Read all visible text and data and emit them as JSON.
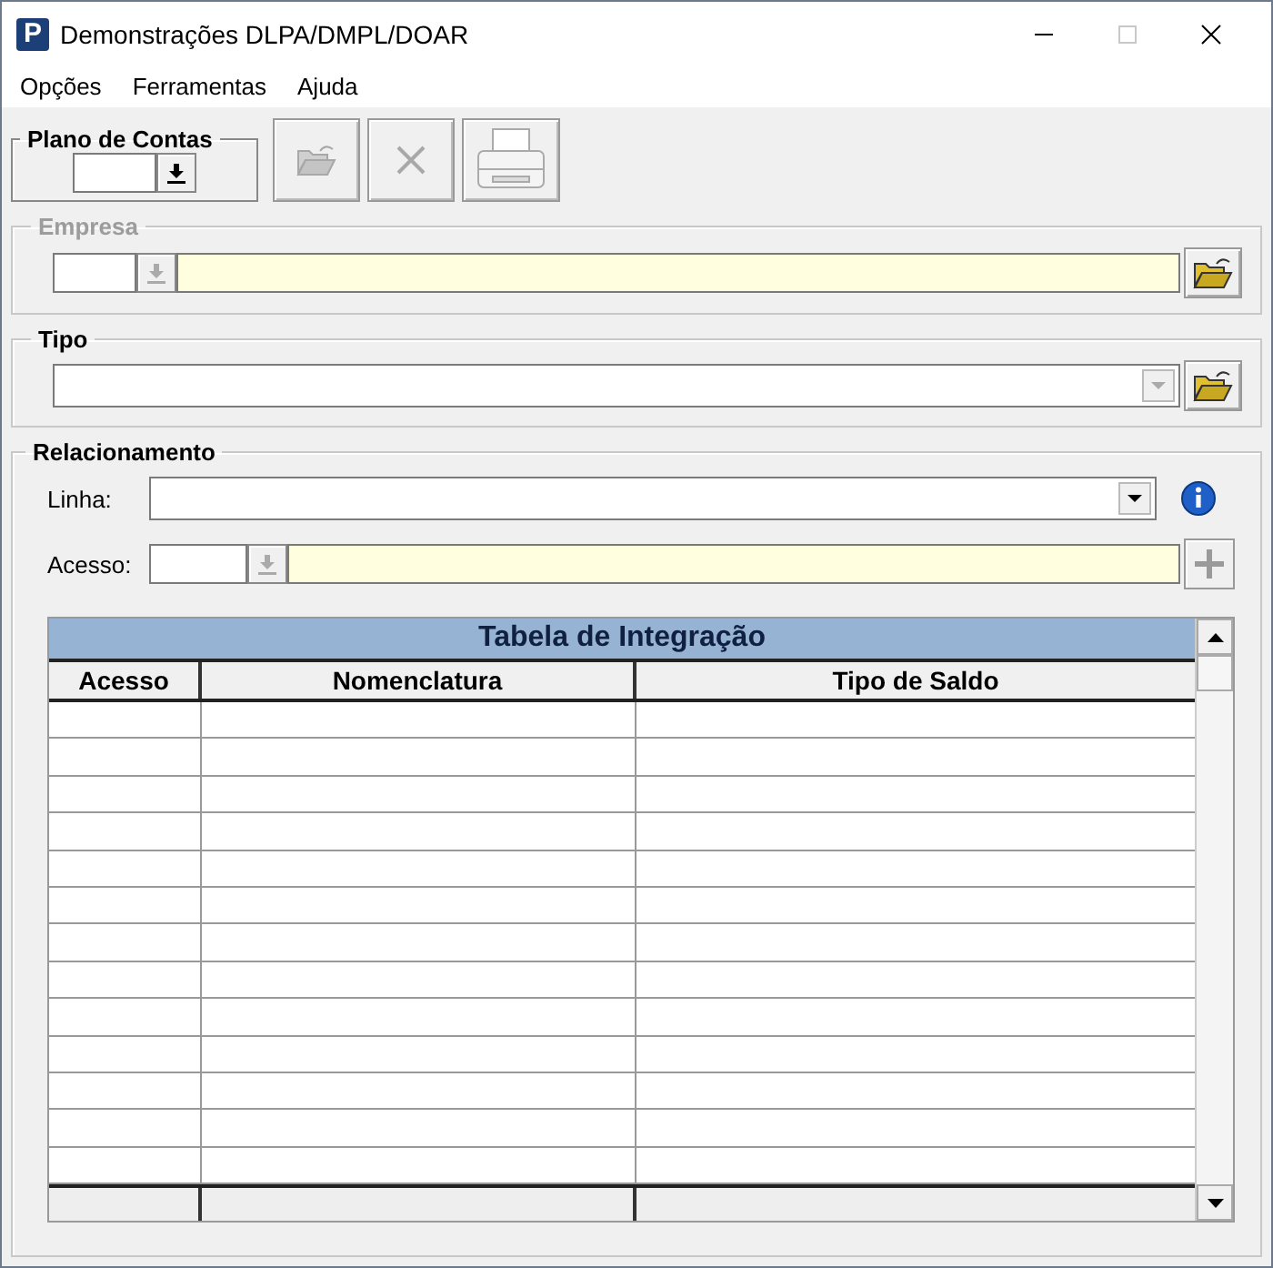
{
  "window": {
    "logo": "P",
    "title": "Demonstrações DLPA/DMPL/DOAR",
    "maximize_disabled": true
  },
  "menu": [
    {
      "label": "Opções"
    },
    {
      "label": "Ferramentas"
    },
    {
      "label": "Ajuda"
    }
  ],
  "plano_de_contas": {
    "legend": "Plano de Contas"
  },
  "toolbar": [
    {
      "kind": "open",
      "disabled": true
    },
    {
      "kind": "delete",
      "disabled": true
    },
    {
      "kind": "print",
      "disabled": true
    }
  ],
  "empresa": {
    "legend": "Empresa",
    "disabled": true
  },
  "tipo": {
    "legend": "Tipo"
  },
  "relacionamento": {
    "legend": "Relacionamento",
    "linha_label": "Linha:",
    "acesso_label": "Acesso:",
    "add_disabled": true
  },
  "table": {
    "title": "Tabela de Integração",
    "columns": [
      "Acesso",
      "Nomenclatura",
      "Tipo de Saldo"
    ]
  }
}
